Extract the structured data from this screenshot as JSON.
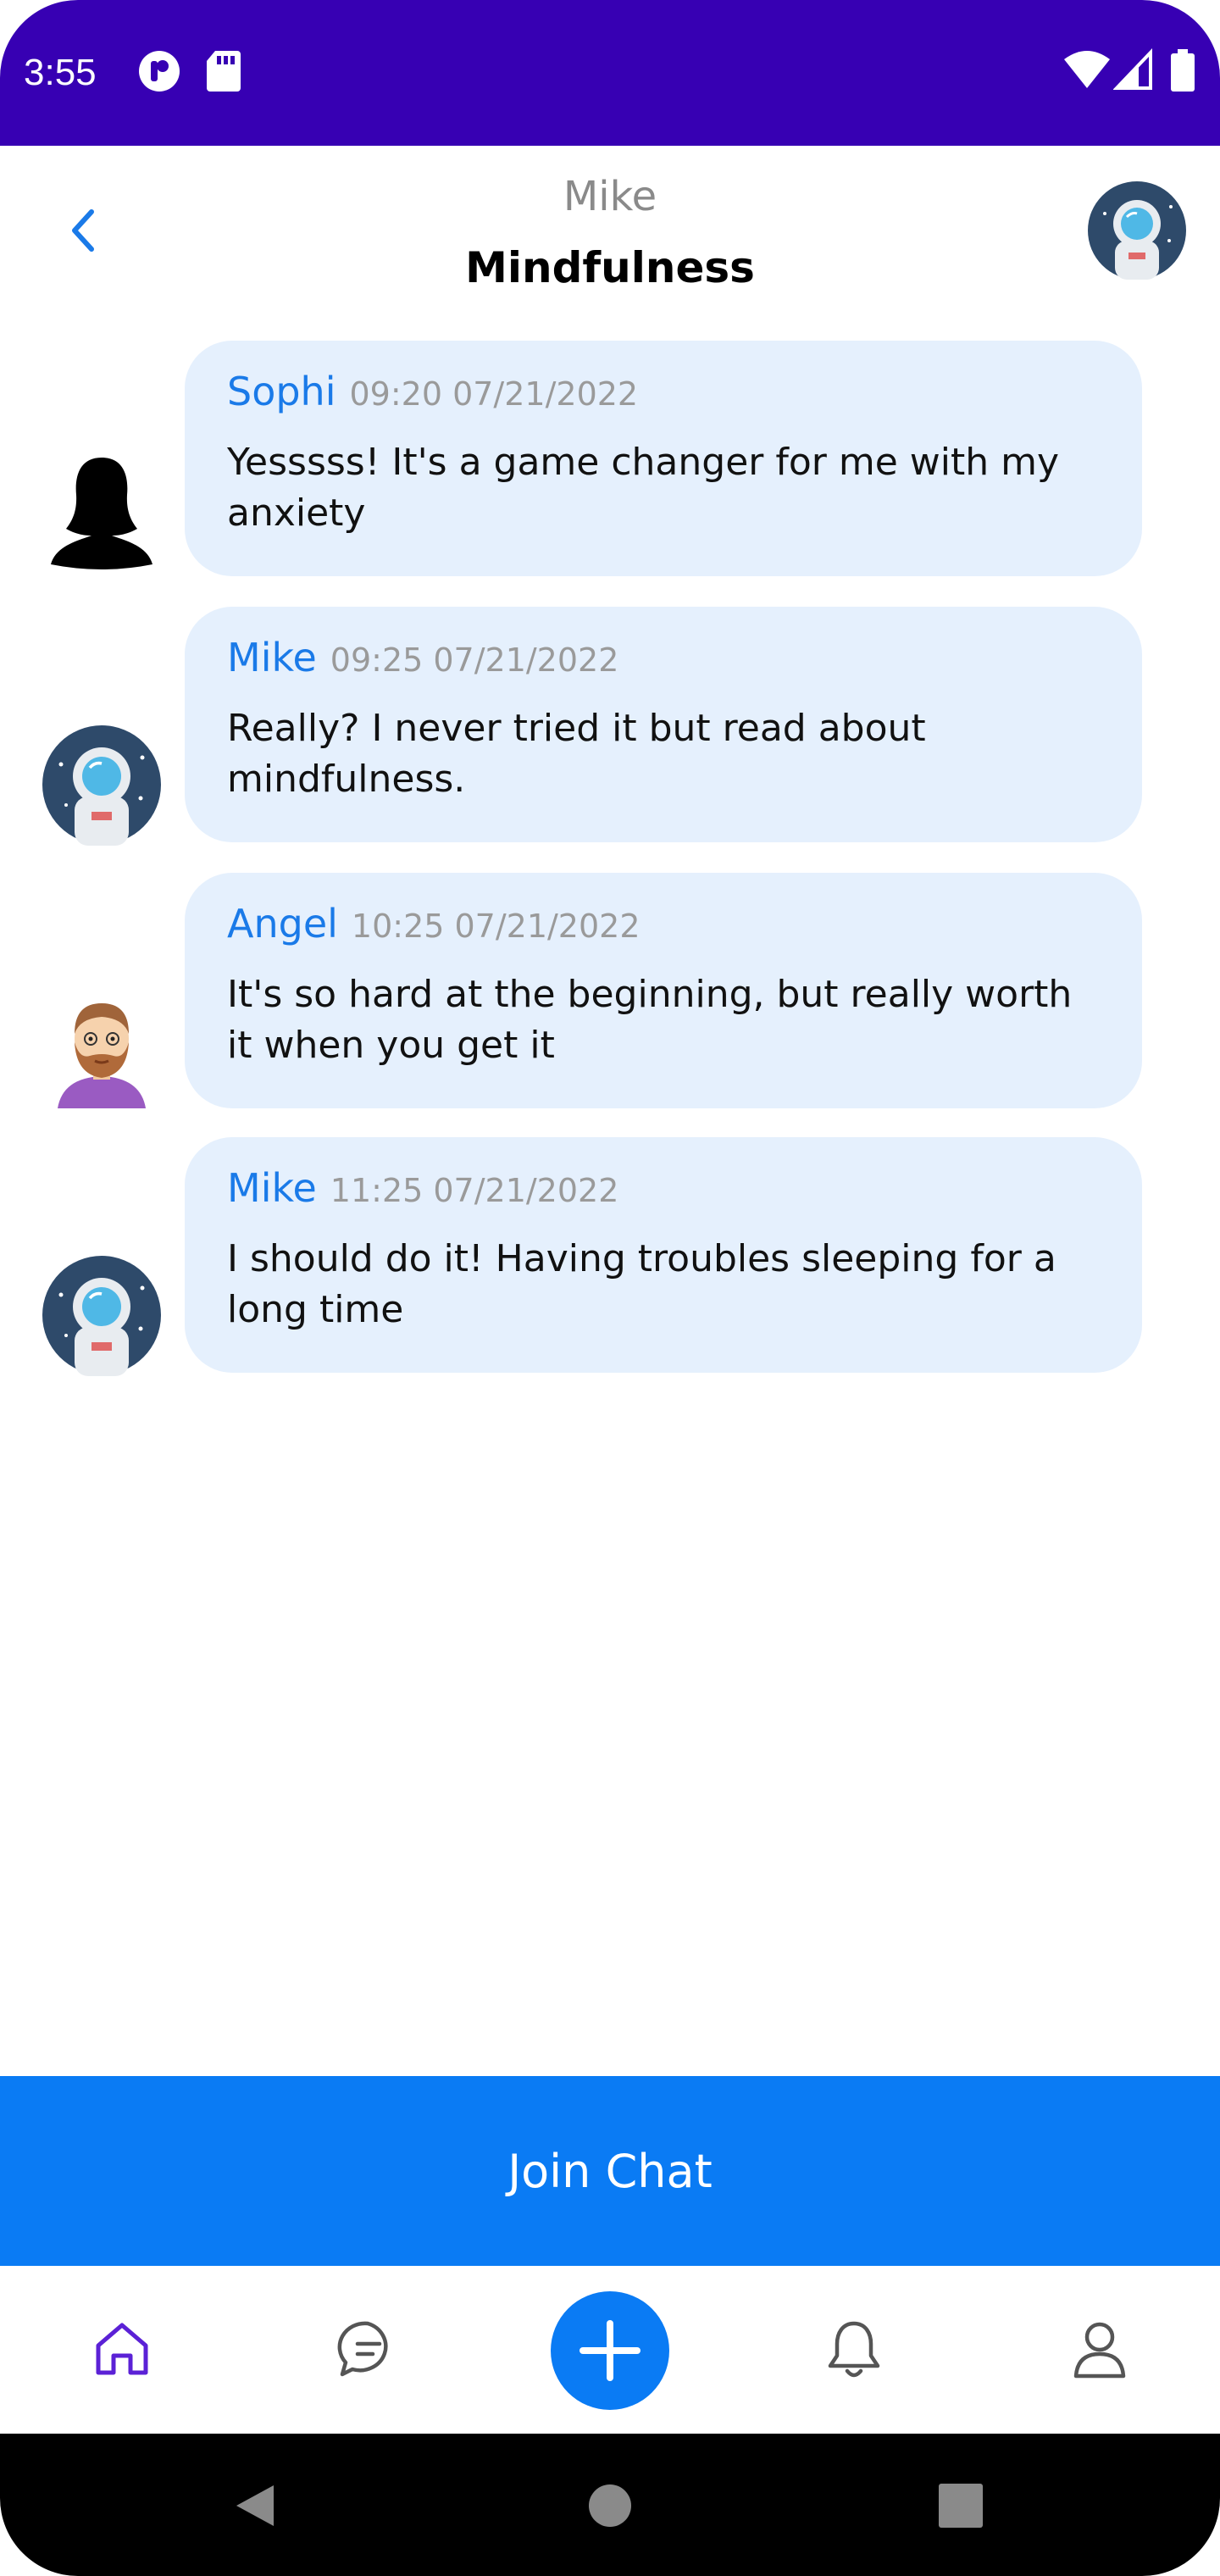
{
  "status_bar": {
    "time": "3:55",
    "bg_color": "#3700b3",
    "icons": [
      "notification-app-icon",
      "sd-card-icon",
      "wifi-icon",
      "signal-icon",
      "battery-icon"
    ]
  },
  "header": {
    "subtitle": "Mike",
    "title": "Mindfulness",
    "back_icon": "chevron-left-icon",
    "avatar": "astronaut-avatar"
  },
  "messages": [
    {
      "sender": "Sophi",
      "timestamp": "09:20 07/21/2022",
      "text": "Yesssss! It's a game changer for me with my anxiety",
      "avatar": "female-silhouette-avatar"
    },
    {
      "sender": "Mike",
      "timestamp": "09:25 07/21/2022",
      "text": "Really? I never tried it but read about mindfulness.",
      "avatar": "astronaut-avatar"
    },
    {
      "sender": "Angel",
      "timestamp": "10:25 07/21/2022",
      "text": "It's so hard at the beginning, but really worth it when you get it",
      "avatar": "bearded-man-avatar"
    },
    {
      "sender": "Mike",
      "timestamp": "11:25 07/21/2022",
      "text": "I should do it! Having troubles sleeping for a long time",
      "avatar": "astronaut-avatar"
    }
  ],
  "join_button": {
    "label": "Join Chat",
    "color": "#0a7bf4"
  },
  "bottom_nav": {
    "items": [
      "home-icon",
      "chat-icon",
      "add-icon",
      "bell-icon",
      "profile-icon"
    ],
    "active": "home-icon",
    "active_color": "#5b21d6"
  },
  "colors": {
    "bubble": "#e5f0fd",
    "sender": "#1a7ae8",
    "timestamp": "#9a9a9a"
  }
}
